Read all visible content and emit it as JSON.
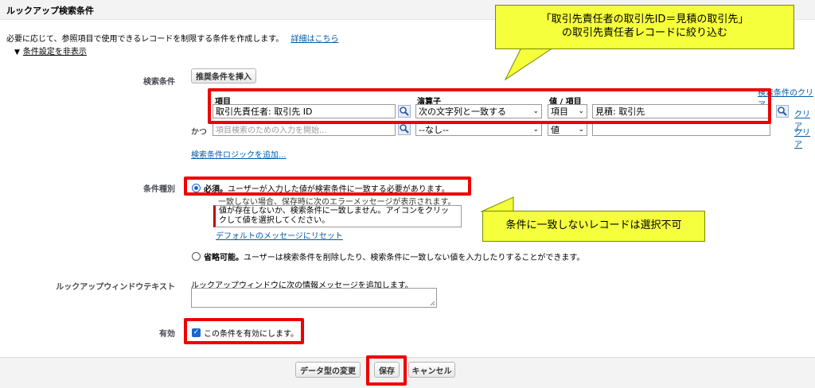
{
  "section": {
    "title": "ルックアップ検索条件"
  },
  "description": {
    "text": "必要に応じて、参照項目で使用できるレコードを制限する条件を作成します。",
    "link": "詳細はこちら"
  },
  "settings_toggle": {
    "label": "条件設定を非表示"
  },
  "filter": {
    "label": "検索条件",
    "insert_button": "推奨条件を挿入",
    "clear_all_link": "検索条件のクリア",
    "column_field": "項目",
    "column_operator": "演算子",
    "column_value": "値 / 項目",
    "and_label": "かつ",
    "add_logic_link": "検索条件ロジックを追加...",
    "rows": [
      {
        "field": "取引先責任者: 取引先 ID",
        "operator": "次の文字列と一致する",
        "value_type": "項目",
        "value": "見積: 取引先",
        "clear": "クリア"
      },
      {
        "field_placeholder": "項目検索のための入力を開始...",
        "operator": "--なし--",
        "value_type": "値",
        "value": "",
        "clear": "クリア"
      }
    ]
  },
  "filter_type": {
    "label": "条件種別",
    "required_bold": "必須。",
    "required_text": "ユーザーが入力した値が検索条件に一致する必要があります。",
    "error_intro": "一致しない場合、保存時に次のエラーメッセージが表示されます。",
    "error_message": "値が存在しないか、検索条件に一致しません。アイコンをクリックして値を選択してください。",
    "reset_link": "デフォルトのメッセージにリセット",
    "optional_bold": "省略可能。",
    "optional_text": "ユーザーは検索条件を削除したり、検索条件に一致しない値を入力したりすることができます。"
  },
  "lookup_window": {
    "label": "ルックアップウィンドウテキスト",
    "hint": "ルックアップウィンドウに次の情報メッセージを追加します。"
  },
  "active": {
    "label": "有効",
    "checkbox_label": "この条件を有効にします。"
  },
  "footer": {
    "change_type": "データ型の変更",
    "save": "保存",
    "cancel": "キャンセル"
  },
  "callouts": {
    "top_line1": "「取引先責任者の取引先ID＝見積の取引先」",
    "top_line2": "の取引先責任者レコードに絞り込む",
    "middle": "条件に一致しないレコードは選択不可"
  },
  "colors": {
    "annotation_red": "#ee0000",
    "callout_yellow": "#f5ff3b",
    "link_blue": "#015ba7"
  }
}
